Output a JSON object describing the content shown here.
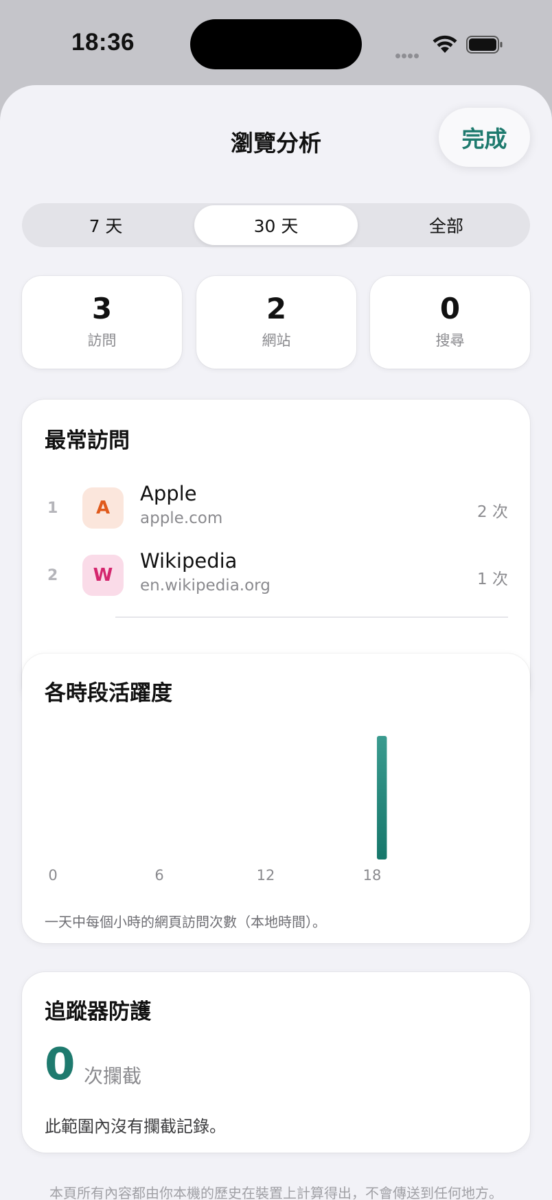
{
  "status_bar": {
    "time": "18:36",
    "icons": [
      "signal-dots-icon",
      "wifi-icon",
      "battery-icon"
    ]
  },
  "nav": {
    "title": "瀏覽分析",
    "done_label": "完成"
  },
  "segments": [
    {
      "label": "7 天",
      "active": false
    },
    {
      "label": "30 天",
      "active": true
    },
    {
      "label": "全部",
      "active": false
    }
  ],
  "stats": [
    {
      "value": "3",
      "label": "訪問"
    },
    {
      "value": "2",
      "label": "網站"
    },
    {
      "value": "0",
      "label": "搜尋"
    }
  ],
  "top_sites": {
    "title": "最常訪問",
    "items": [
      {
        "rank": "1",
        "letter": "A",
        "name": "Apple",
        "domain": "apple.com",
        "count": "2 次",
        "icon_bg": "#fbe6dc",
        "icon_fg": "#e05a1c"
      },
      {
        "rank": "2",
        "letter": "W",
        "name": "Wikipedia",
        "domain": "en.wikipedia.org",
        "count": "1 次",
        "icon_bg": "#fadbe8",
        "icon_fg": "#d4266e"
      }
    ]
  },
  "activity": {
    "title": "各時段活躍度",
    "caption": "一天中每個小時的網頁訪問次數（本地時間）。"
  },
  "chart_data": {
    "type": "bar",
    "x_ticks": [
      "0",
      "6",
      "12",
      "18"
    ],
    "x_range": [
      0,
      23
    ],
    "hours": [
      0,
      1,
      2,
      3,
      4,
      5,
      6,
      7,
      8,
      9,
      10,
      11,
      12,
      13,
      14,
      15,
      16,
      17,
      18,
      19,
      20,
      21,
      22,
      23
    ],
    "values": [
      0,
      0,
      0,
      0,
      0,
      0,
      0,
      0,
      0,
      0,
      0,
      0,
      0,
      0,
      0,
      0,
      0,
      0,
      3,
      0,
      0,
      0,
      0,
      0
    ],
    "bar_color_top": "#3a9b8f",
    "bar_color_bottom": "#16776b",
    "grid": false
  },
  "tracker": {
    "title": "追蹤器防護",
    "count": "0",
    "unit": "次攔截",
    "note": "此範圍內沒有攔截記錄。"
  },
  "footer": {
    "note": "本頁所有內容都由你本機的歷史在裝置上計算得出，不會傳送到任何地方。"
  },
  "colors": {
    "accent": "#1e7a6e",
    "background": "#f2f2f7"
  }
}
